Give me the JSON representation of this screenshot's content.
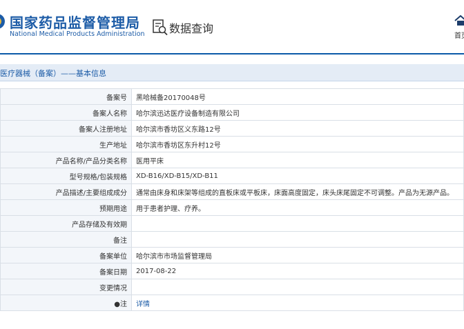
{
  "header": {
    "agency_cn": "国家药品监督管理局",
    "agency_en": "National Medical Products Administration",
    "query_title": "数据查询",
    "home_label": "首页"
  },
  "breadcrumb": "医疗器械（备案）——基本信息",
  "colors": {
    "brand_blue": "#1d5ca7",
    "header_line": "#0a5aa8",
    "label_bg": "#f3f6fa"
  },
  "rows": [
    {
      "label": "备案号",
      "value": "黑哈械备20170048号"
    },
    {
      "label": "备案人名称",
      "value": "哈尔滨迅达医疗设备制造有限公司"
    },
    {
      "label": "备案人注册地址",
      "value": "哈尔滨市香坊区义东路12号"
    },
    {
      "label": "生产地址",
      "value": "哈尔滨市香坊区东升村12号"
    },
    {
      "label": "产品名称/产品分类名称",
      "value": "医用平床"
    },
    {
      "label": "型号规格/包装规格",
      "value": "XD-B16/XD-B15/XD-B11"
    },
    {
      "label": "产品描述/主要组成成分",
      "value": "通常由床身和床架等组成的直板床或平板床，床面高度固定，床头床尾固定不可调整。产品为无源产品。"
    },
    {
      "label": "预期用途",
      "value": "用于患者护理、疗养。"
    },
    {
      "label": "产品存储及有效期",
      "value": ""
    },
    {
      "label": "备注",
      "value": ""
    },
    {
      "label": "备案单位",
      "value": "哈尔滨市市场监督管理局"
    },
    {
      "label": "备案日期",
      "value": "2017-08-22"
    },
    {
      "label": "变更情况",
      "value": ""
    },
    {
      "label": "●注",
      "value": "详情"
    }
  ]
}
